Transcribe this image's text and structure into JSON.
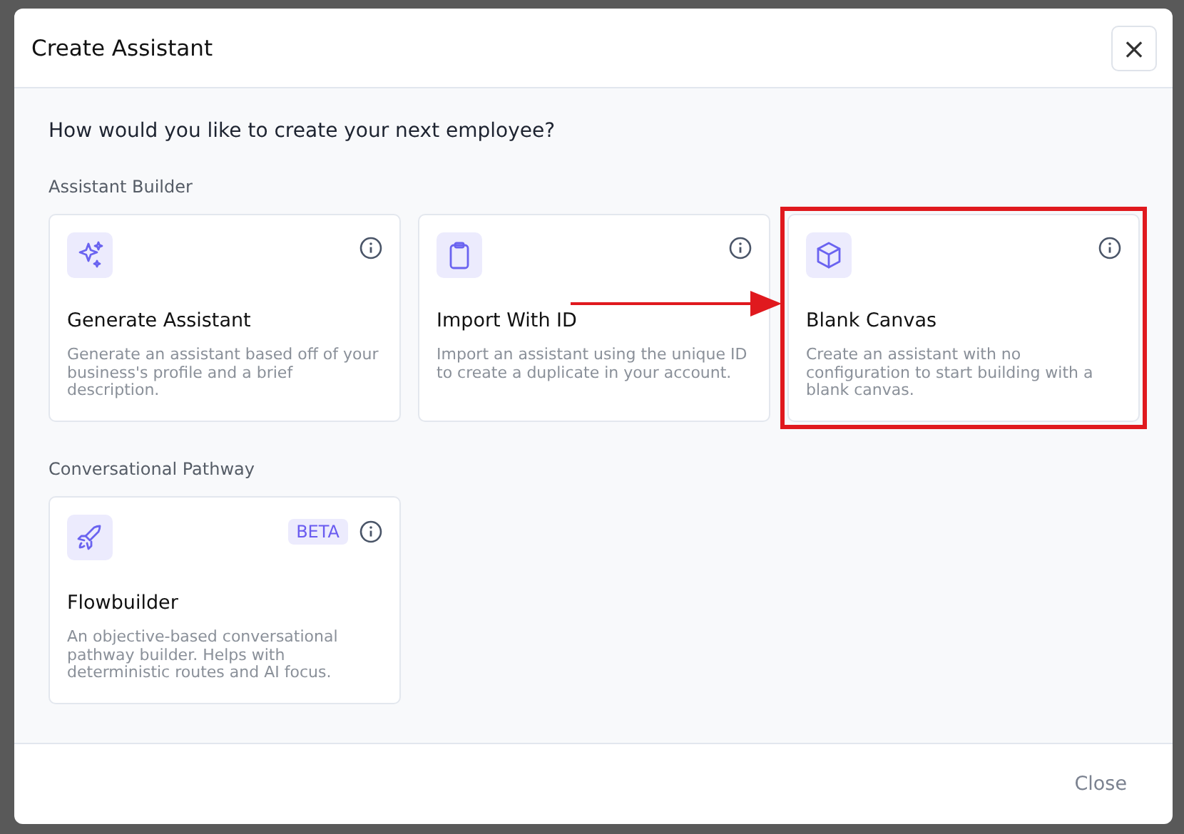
{
  "dialog": {
    "title": "Create Assistant",
    "close_icon": "×"
  },
  "question": "How would you like to create your next employee?",
  "sections": [
    {
      "label": "Assistant Builder",
      "cards": [
        {
          "title": "Generate Assistant",
          "description": "Generate an assistant based off of your business's profile and a brief description.",
          "highlighted": false
        },
        {
          "title": "Import With ID",
          "description": "Import an assistant using the unique ID to create a duplicate in your account.",
          "highlighted": false
        },
        {
          "title": "Blank Canvas",
          "description": "Create an assistant with no configuration to start building with a blank canvas.",
          "highlighted": true
        }
      ]
    },
    {
      "label": "Conversational Pathway",
      "cards": [
        {
          "title": "Flowbuilder",
          "badge": "BETA",
          "description": "An objective-based conversational pathway builder. Helps with deterministic routes and AI focus.",
          "highlighted": false
        }
      ]
    }
  ],
  "footer": {
    "close_button": "Close"
  }
}
